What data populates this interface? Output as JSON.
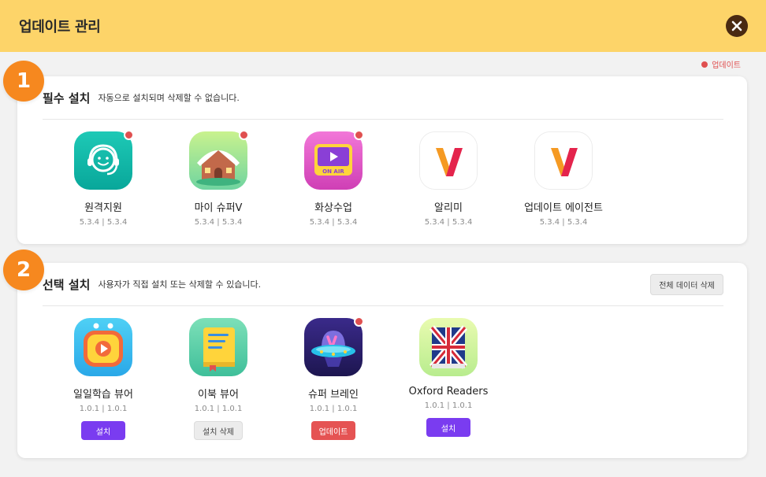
{
  "header": {
    "title": "업데이트 관리"
  },
  "legend": {
    "label": "업데이트"
  },
  "sections": [
    {
      "number": "1",
      "title": "필수 설치",
      "description": "자동으로 설치되며 삭제할 수 없습니다.",
      "apps": [
        {
          "name": "원격지원",
          "version": "5.3.4 | 5.3.4",
          "update": true,
          "icon": "headset-icon"
        },
        {
          "name": "마이 슈퍼V",
          "version": "5.3.4 | 5.3.4",
          "update": true,
          "icon": "house-icon"
        },
        {
          "name": "화상수업",
          "version": "5.3.4 | 5.3.4",
          "update": true,
          "icon": "on-air-icon",
          "icon_text": "ON AIR"
        },
        {
          "name": "알리미",
          "version": "5.3.4 | 5.3.4",
          "update": false,
          "icon": "v-logo-icon"
        },
        {
          "name": "업데이트 에이전트",
          "version": "5.3.4 | 5.3.4",
          "update": false,
          "icon": "v-logo-icon"
        }
      ]
    },
    {
      "number": "2",
      "title": "선택 설치",
      "description": "사용자가 직접 설치 또는 삭제할 수 있습니다.",
      "action_label": "전체 데이터 삭제",
      "apps": [
        {
          "name": "일일학습 뷰어",
          "version": "1.0.1 | 1.0.1",
          "update": false,
          "icon": "tv-play-icon",
          "button": "설치",
          "button_type": "install"
        },
        {
          "name": "이북 뷰어",
          "version": "1.0.1 | 1.0.1",
          "update": false,
          "icon": "book-icon",
          "button": "설치 삭제",
          "button_type": "remove"
        },
        {
          "name": "슈퍼 브레인",
          "version": "1.0.1 | 1.0.1",
          "update": true,
          "icon": "ufo-icon",
          "button": "업데이트",
          "button_type": "update"
        },
        {
          "name": "Oxford Readers",
          "version": "1.0.1 | 1.0.1",
          "update": false,
          "icon": "union-flag-book-icon",
          "button": "설치",
          "button_type": "install"
        }
      ]
    }
  ],
  "colors": {
    "header_bg": "#fdd469",
    "badge": "#f6881f",
    "update_dot": "#e05050",
    "install_btn": "#7a3cf0",
    "update_btn": "#e55353"
  }
}
